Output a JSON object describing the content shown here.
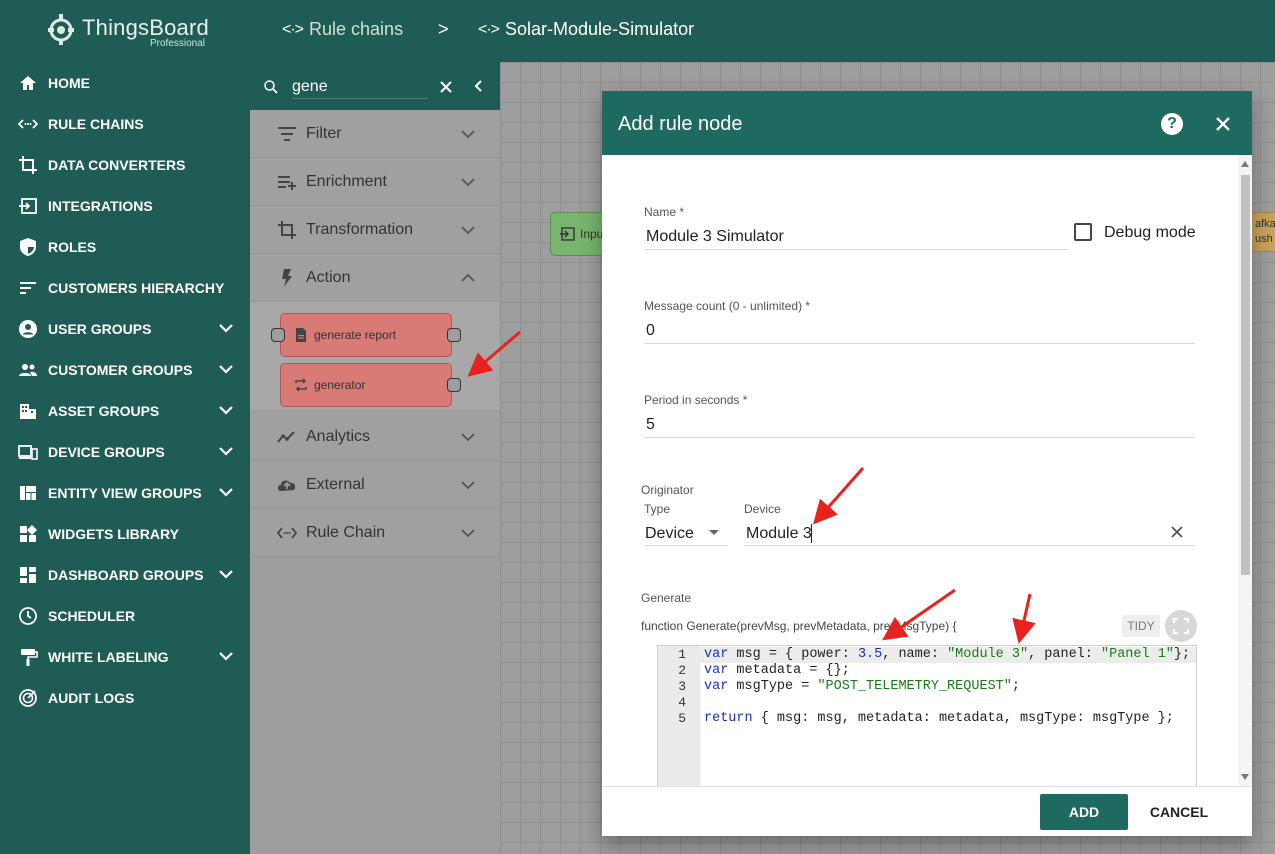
{
  "app": {
    "name": "ThingsBoard",
    "edition": "Professional"
  },
  "breadcrumb": {
    "root": "Rule chains",
    "separator": ">",
    "current": "Solar-Module-Simulator",
    "icon": "<·>"
  },
  "sidebar": {
    "items": [
      {
        "label": "HOME",
        "icon": "home-icon",
        "chevron": false
      },
      {
        "label": "RULE CHAINS",
        "icon": "rule-chains-icon",
        "chevron": false
      },
      {
        "label": "DATA CONVERTERS",
        "icon": "crop-icon",
        "chevron": false
      },
      {
        "label": "INTEGRATIONS",
        "icon": "input-icon",
        "chevron": false
      },
      {
        "label": "ROLES",
        "icon": "shield-icon",
        "chevron": false
      },
      {
        "label": "CUSTOMERS HIERARCHY",
        "icon": "sort-icon",
        "chevron": false
      },
      {
        "label": "USER GROUPS",
        "icon": "account-circle-icon",
        "chevron": true
      },
      {
        "label": "CUSTOMER GROUPS",
        "icon": "people-icon",
        "chevron": true
      },
      {
        "label": "ASSET GROUPS",
        "icon": "domain-icon",
        "chevron": true
      },
      {
        "label": "DEVICE GROUPS",
        "icon": "devices-icon",
        "chevron": true
      },
      {
        "label": "ENTITY VIEW GROUPS",
        "icon": "view-quilt-icon",
        "chevron": true
      },
      {
        "label": "WIDGETS LIBRARY",
        "icon": "widgets-icon",
        "chevron": false
      },
      {
        "label": "DASHBOARD GROUPS",
        "icon": "dashboard-icon",
        "chevron": true
      },
      {
        "label": "SCHEDULER",
        "icon": "schedule-icon",
        "chevron": false
      },
      {
        "label": "WHITE LABELING",
        "icon": "format-paint-icon",
        "chevron": true
      },
      {
        "label": "AUDIT LOGS",
        "icon": "track-changes-icon",
        "chevron": false
      }
    ]
  },
  "library": {
    "search_value": "gene",
    "categories": [
      "Filter",
      "Enrichment",
      "Transformation",
      "Action",
      "Analytics",
      "External",
      "Rule Chain"
    ],
    "action_nodes": [
      "generate report",
      "generator"
    ]
  },
  "canvas": {
    "input_node": "Inpu",
    "right_node_line1": "afka",
    "right_node_line2": "ush t"
  },
  "dialog": {
    "title": "Add rule node",
    "name_label": "Name *",
    "name_value": "Module 3 Simulator",
    "debug_label": "Debug mode",
    "msg_count_label": "Message count (0 - unlimited) *",
    "msg_count_value": "0",
    "period_label": "Period in seconds *",
    "period_value": "5",
    "originator_label": "Originator",
    "type_label": "Type",
    "type_value": "Device",
    "device_label": "Device",
    "device_value": "Module 3",
    "generate_label": "Generate",
    "function_signature": "function Generate(prevMsg, prevMetadata, prevMsgType) {",
    "tidy_label": "TIDY",
    "code_lines": [
      "1",
      "2",
      "3",
      "4",
      "5"
    ],
    "add_label": "ADD",
    "cancel_label": "CANCEL"
  },
  "colors": {
    "primary": "#1f5c55",
    "dialog_header": "#1f6a60",
    "action_node": "#d87a76",
    "arrow": "#e8231f"
  }
}
